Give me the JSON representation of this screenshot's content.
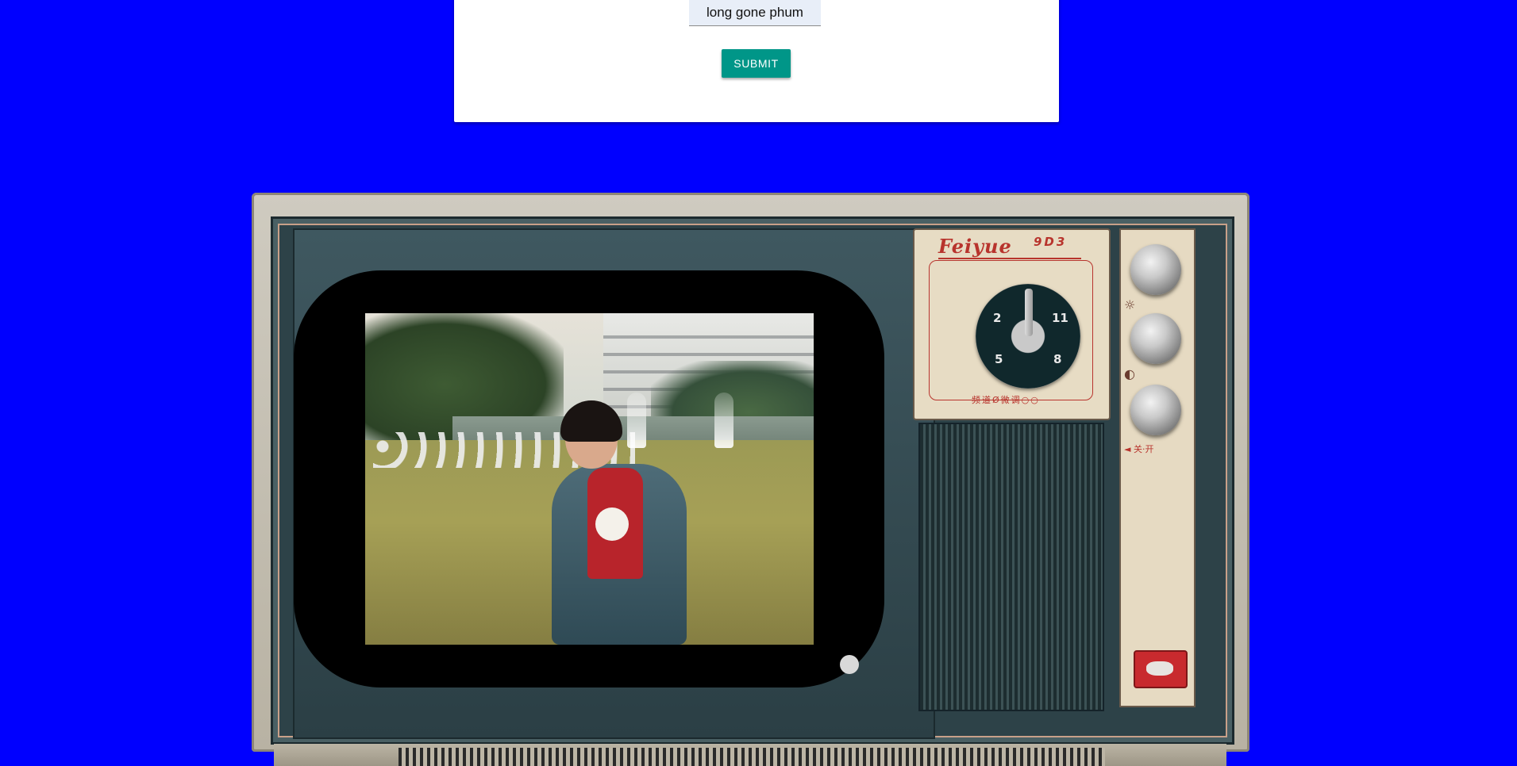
{
  "form": {
    "search_value": "long gone phum",
    "submit_label": "SUBMIT"
  },
  "tv": {
    "brand": "Feiyue",
    "model": "9D3",
    "dial_numbers": [
      "2",
      "11",
      "5",
      "8"
    ],
    "dial_caption": "频道Ø微调○○",
    "power_label": "◄ 关·开"
  },
  "colors": {
    "page_background": "#0000ff",
    "submit_button": "#009688",
    "card_background": "#ffffff"
  }
}
